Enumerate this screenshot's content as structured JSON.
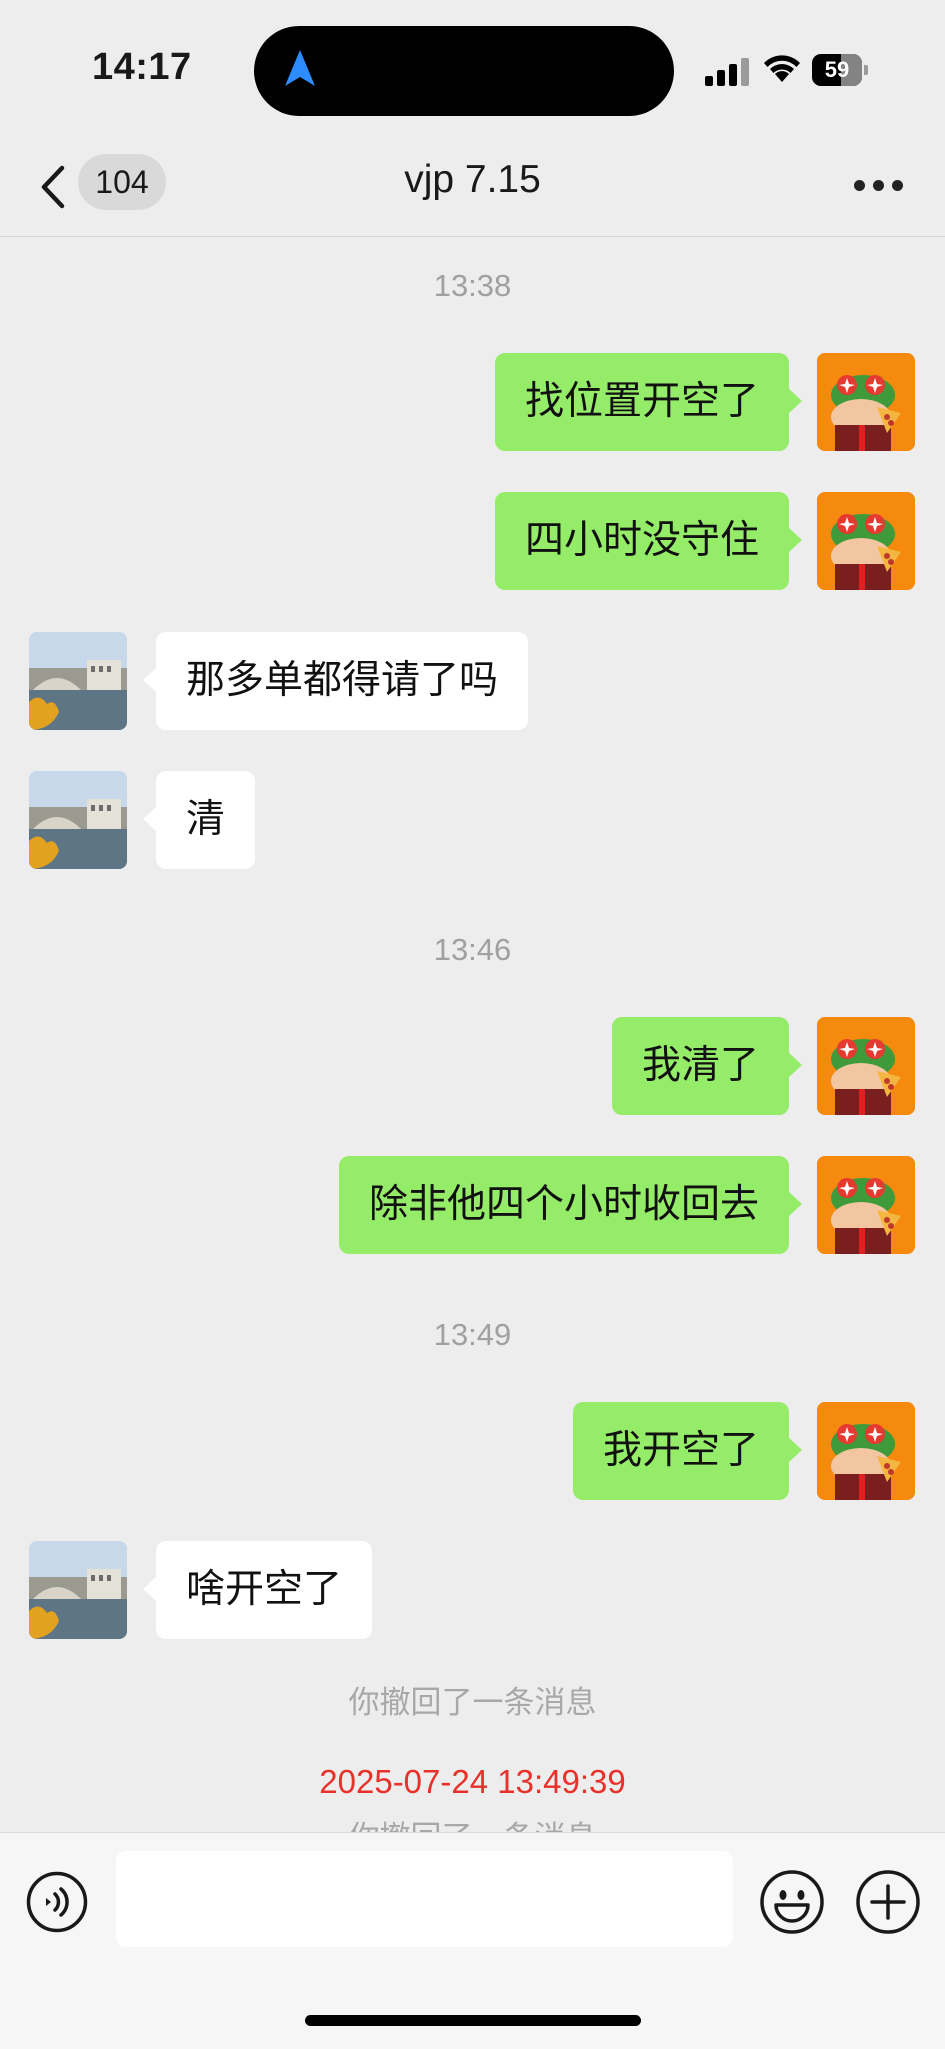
{
  "status_bar": {
    "time": "14:17",
    "battery": "59"
  },
  "header": {
    "unread_count": "104",
    "title": "vjp 7.15"
  },
  "messages": [
    {
      "type": "time",
      "text": "13:38"
    },
    {
      "type": "out",
      "text": "找位置开空了"
    },
    {
      "type": "out",
      "text": "四小时没守住"
    },
    {
      "type": "in",
      "text": "那多单都得请了吗"
    },
    {
      "type": "in",
      "text": "清"
    },
    {
      "type": "time",
      "text": "13:46"
    },
    {
      "type": "out",
      "text": "我清了"
    },
    {
      "type": "out",
      "text": "除非他四个小时收回去"
    },
    {
      "type": "time",
      "text": "13:49"
    },
    {
      "type": "out",
      "text": "我开空了"
    },
    {
      "type": "in",
      "text": "啥开空了"
    },
    {
      "type": "system",
      "text": "你撤回了一条消息"
    },
    {
      "type": "red_time",
      "text": "2025-07-24 13:49:39"
    },
    {
      "type": "system_partial",
      "text": "你撤回了一条消息"
    }
  ],
  "input": {
    "value": "",
    "placeholder": ""
  },
  "colors": {
    "outgoing_bubble": "#95ec69",
    "incoming_bubble": "#ffffff",
    "background": "#ededed",
    "recall_time": "#e8312a"
  }
}
